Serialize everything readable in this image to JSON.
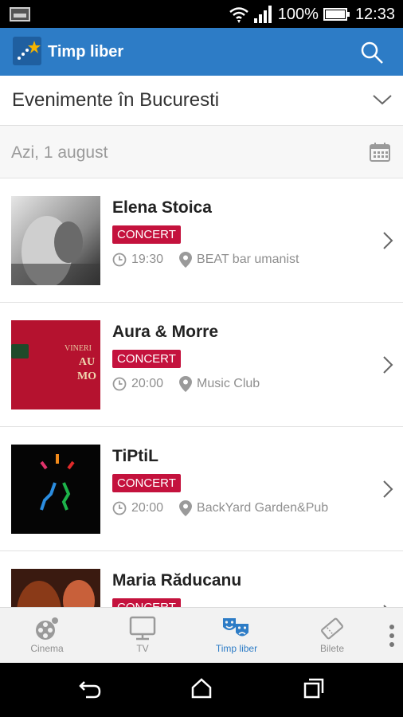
{
  "status_bar": {
    "battery": "100%",
    "time": "12:33"
  },
  "app_bar": {
    "title": "Timp liber"
  },
  "filter": {
    "city_label": "Evenimente în Bucuresti"
  },
  "date_header": {
    "label": "Azi, 1 august"
  },
  "events": [
    {
      "title": "Elena Stoica",
      "category": "CONCERT",
      "time": "19:30",
      "venue": "BEAT bar umanist"
    },
    {
      "title": "Aura & Morre",
      "category": "CONCERT",
      "time": "20:00",
      "venue": "Music Club"
    },
    {
      "title": "TiPtiL",
      "category": "CONCERT",
      "time": "20:00",
      "venue": "BackYard Garden&Pub"
    },
    {
      "title": "Maria Răducanu",
      "category": "CONCERT",
      "time": "",
      "venue": ""
    }
  ],
  "thumb_texts": {
    "event1_line1": "VINERI",
    "event1_line2": "AU",
    "event1_line3": "MO"
  },
  "tabs": [
    {
      "label": "Cinema",
      "icon": "film-reel-icon"
    },
    {
      "label": "TV",
      "icon": "tv-icon"
    },
    {
      "label": "Timp liber",
      "icon": "theater-masks-icon",
      "active": true
    },
    {
      "label": "Bilete",
      "icon": "ticket-icon"
    }
  ],
  "colors": {
    "primary": "#2d7cc6",
    "badge": "#c4123d"
  }
}
